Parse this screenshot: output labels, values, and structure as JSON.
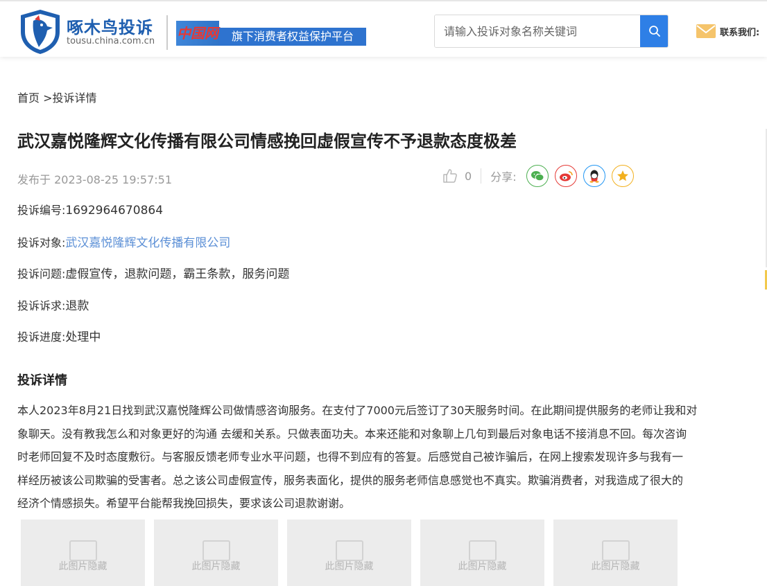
{
  "header": {
    "logo_title": "啄木鸟投诉",
    "logo_url": "tousu.china.com.cn",
    "partner_mark": "中国网",
    "partner_text": "旗下消费者权益保护平台",
    "search_placeholder": "请输入投诉对象名称关键词",
    "contact_label": "联系我们:"
  },
  "breadcrumb": {
    "home": "首页",
    "sep": " >",
    "current": "投诉详情"
  },
  "complaint": {
    "title": "武汉嘉悦隆辉文化传播有限公司情感挽回虚假宣传不予退款态度极差",
    "published": "发布于 2023-08-25 19:57:51",
    "likes": "0",
    "share_label": "分享:",
    "fields": [
      {
        "key": "投诉编号:",
        "value": "1692964670864"
      },
      {
        "key": "投诉对象:",
        "value": "武汉嘉悦隆辉文化传播有限公司"
      },
      {
        "key": "投诉问题:",
        "value": "虚假宣传，退款问题，霸王条款，服务问题"
      },
      {
        "key": "投诉诉求:",
        "value": "退款"
      },
      {
        "key": "投诉进度:",
        "value": "处理中"
      }
    ],
    "detail_heading": "投诉详情",
    "detail_lines": [
      "本人2023年8月21日找到武汉嘉悦隆辉公司做情感咨询服务。在支付了7000元后签订了30天服务时间。在此期间提供服务的老师让我和对",
      "象聊天。没有教我怎么和对象更好的沟通 去缓和关系。只做表面功夫。本来还能和对象聊上几句到最后对象电话不接消息不回。每次咨询",
      "时老师回复不及时态度敷衍。与客服反馈老师专业水平问题，也得不到应有的答复。后感觉自己被诈骗后，在网上搜索发现许多与我有一",
      "样经历被该公司欺骗的受害者。总之该公司虚假宣传，服务表面化，提供的服务老师信息感觉也不真实。欺骗消费者，对我造成了很大的",
      "经济个情感损失。希望平台能帮我挽回损失，要求该公司退款谢谢。"
    ],
    "image_placeholders": [
      "此图片隐藏",
      "此图片隐藏",
      "此图片隐藏",
      "此图片隐藏",
      "此图片隐藏"
    ]
  },
  "colors": {
    "brand_blue": "#1f5fb0",
    "search_button": "#2e7fe6",
    "link": "#5b8fd6",
    "wechat": "#4caf50",
    "weibo": "#e53935",
    "qq": "#2196f3",
    "qzone": "#f2b01e"
  },
  "icons": [
    "shield-woodpecker-logo-icon",
    "search-icon",
    "envelope-icon",
    "thumbs-up-icon",
    "wechat-icon",
    "weibo-icon",
    "qq-icon",
    "qzone-star-icon",
    "image-placeholder-icon"
  ]
}
